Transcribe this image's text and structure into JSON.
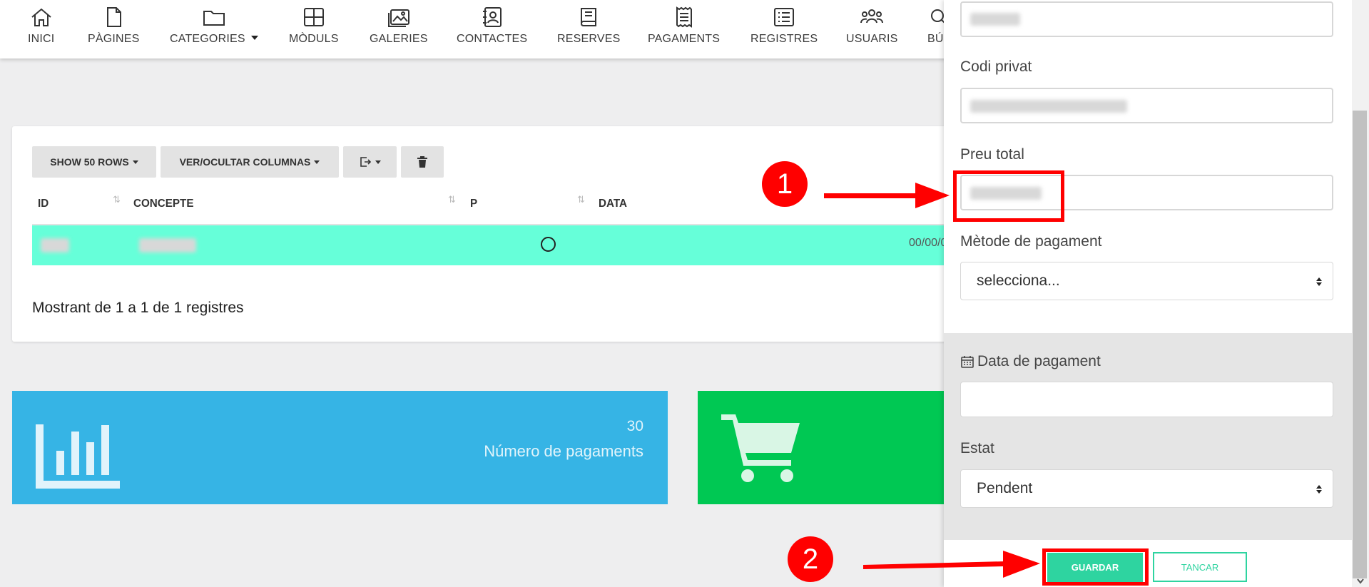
{
  "nav": {
    "items": [
      {
        "label": "INICI",
        "icon": "home-icon"
      },
      {
        "label": "PÀGINES",
        "icon": "page-icon"
      },
      {
        "label": "CATEGORIES",
        "icon": "folder-icon"
      },
      {
        "label": "MÒDULS",
        "icon": "grid-icon"
      },
      {
        "label": "GALERIES",
        "icon": "images-icon"
      },
      {
        "label": "CONTACTES",
        "icon": "contacts-icon"
      },
      {
        "label": "RESERVES",
        "icon": "book-icon"
      },
      {
        "label": "PAGAMENTS",
        "icon": "receipt-icon"
      },
      {
        "label": "REGISTRES",
        "icon": "list-icon"
      },
      {
        "label": "USUARIS",
        "icon": "users-icon"
      },
      {
        "label": "BÚ",
        "icon": "search-icon"
      }
    ]
  },
  "table": {
    "buttons": {
      "rows": "SHOW 50 ROWS",
      "columns": "VER/OCULTAR COLUMNAS"
    },
    "headers": {
      "id": "ID",
      "concept": "CONCEPTE",
      "p": "P",
      "date": "DATA"
    },
    "row": {
      "date": "00/00/00"
    },
    "footer": "Mostrant de 1 a 1 de 1 registres"
  },
  "stats": {
    "payments_count": "30",
    "payments_label": "Número de pagaments"
  },
  "panel": {
    "codi_privat_label": "Codi privat",
    "preu_total_label": "Preu total",
    "metode_label": "Mètode de pagament",
    "metode_value": "selecciona...",
    "data_label": "Data de pagament",
    "estat_label": "Estat",
    "estat_value": "Pendent",
    "save_label": "GUARDAR",
    "close_label": "TANCAR"
  },
  "annotations": {
    "step1": "1",
    "step2": "2"
  },
  "colors": {
    "accent": "#2ed4a0",
    "row_highlight": "#66ffd9",
    "stat_blue": "#36b4e5",
    "stat_green": "#00c853",
    "annotation_red": "#ff0000"
  }
}
